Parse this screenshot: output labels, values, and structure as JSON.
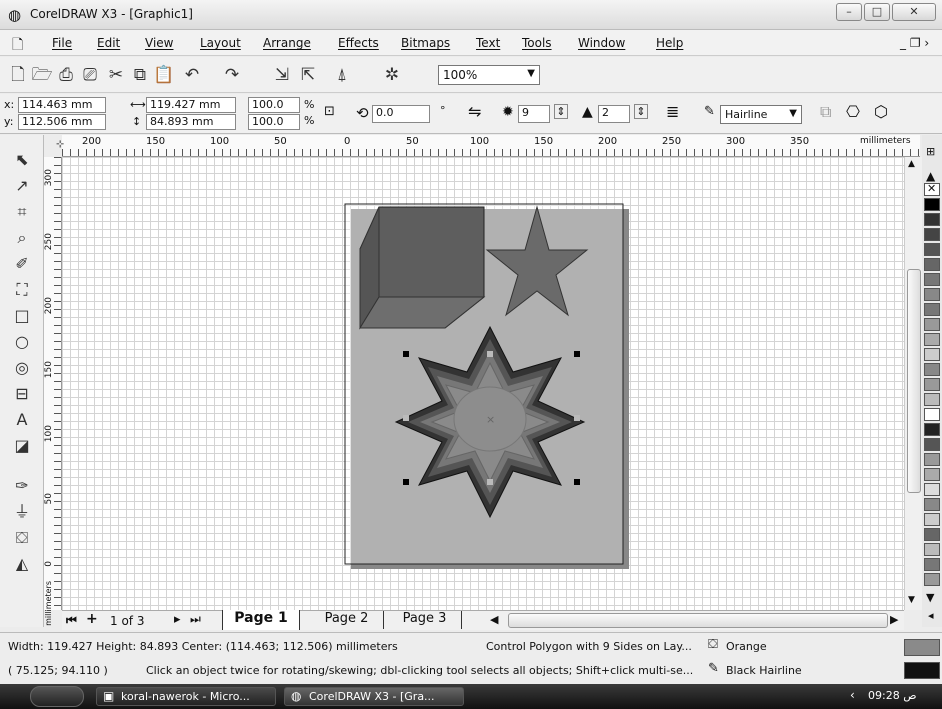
{
  "window": {
    "title": "CorelDRAW X3 - [Graphic1]"
  },
  "menu": [
    "File",
    "Edit",
    "View",
    "Layout",
    "Arrange",
    "Effects",
    "Bitmaps",
    "Text",
    "Tools",
    "Window",
    "Help"
  ],
  "zoom": "100%",
  "props": {
    "x_label": "x:",
    "x": "114.463 mm",
    "y_label": "y:",
    "y": "112.506 mm",
    "w": "119.427 mm",
    "h": "84.893 mm",
    "scale_x": "100.0",
    "scale_y": "100.0",
    "pct1": "%",
    "pct2": "%",
    "rotation": "0.0",
    "deg": "°",
    "sides": "9",
    "sharpness": "2",
    "outline": "Hairline"
  },
  "rulers": {
    "h_ticks": [
      "200",
      "150",
      "100",
      "50",
      "0",
      "50",
      "100",
      "150",
      "200",
      "250",
      "300",
      "350"
    ],
    "h_unit": "millimeters",
    "v_ticks": [
      "300",
      "250",
      "200",
      "150",
      "100",
      "50",
      "0"
    ],
    "v_unit": "millimeters"
  },
  "pages": {
    "nav": "1 of 3",
    "tabs": [
      "Page 1",
      "Page 2",
      "Page 3"
    ]
  },
  "status": {
    "dims": "Width: 119.427  Height: 84.893  Center: (114.463; 112.506)  millimeters",
    "object": "Control Polygon with 9 Sides on Lay...",
    "fill": "Orange",
    "coords": "( 75.125; 94.110 )",
    "hint": "Click an object twice for rotating/skewing; dbl-clicking tool selects all objects; Shift+click multi-se...",
    "outline": "Black  Hairline"
  },
  "taskbar": {
    "items": [
      "koral-nawerok - Micro...",
      "CorelDRAW X3 - [Gra..."
    ],
    "clock": "09:28 ص"
  },
  "colors": {
    "fill": "#8a8a8a",
    "outline": "#111111"
  }
}
